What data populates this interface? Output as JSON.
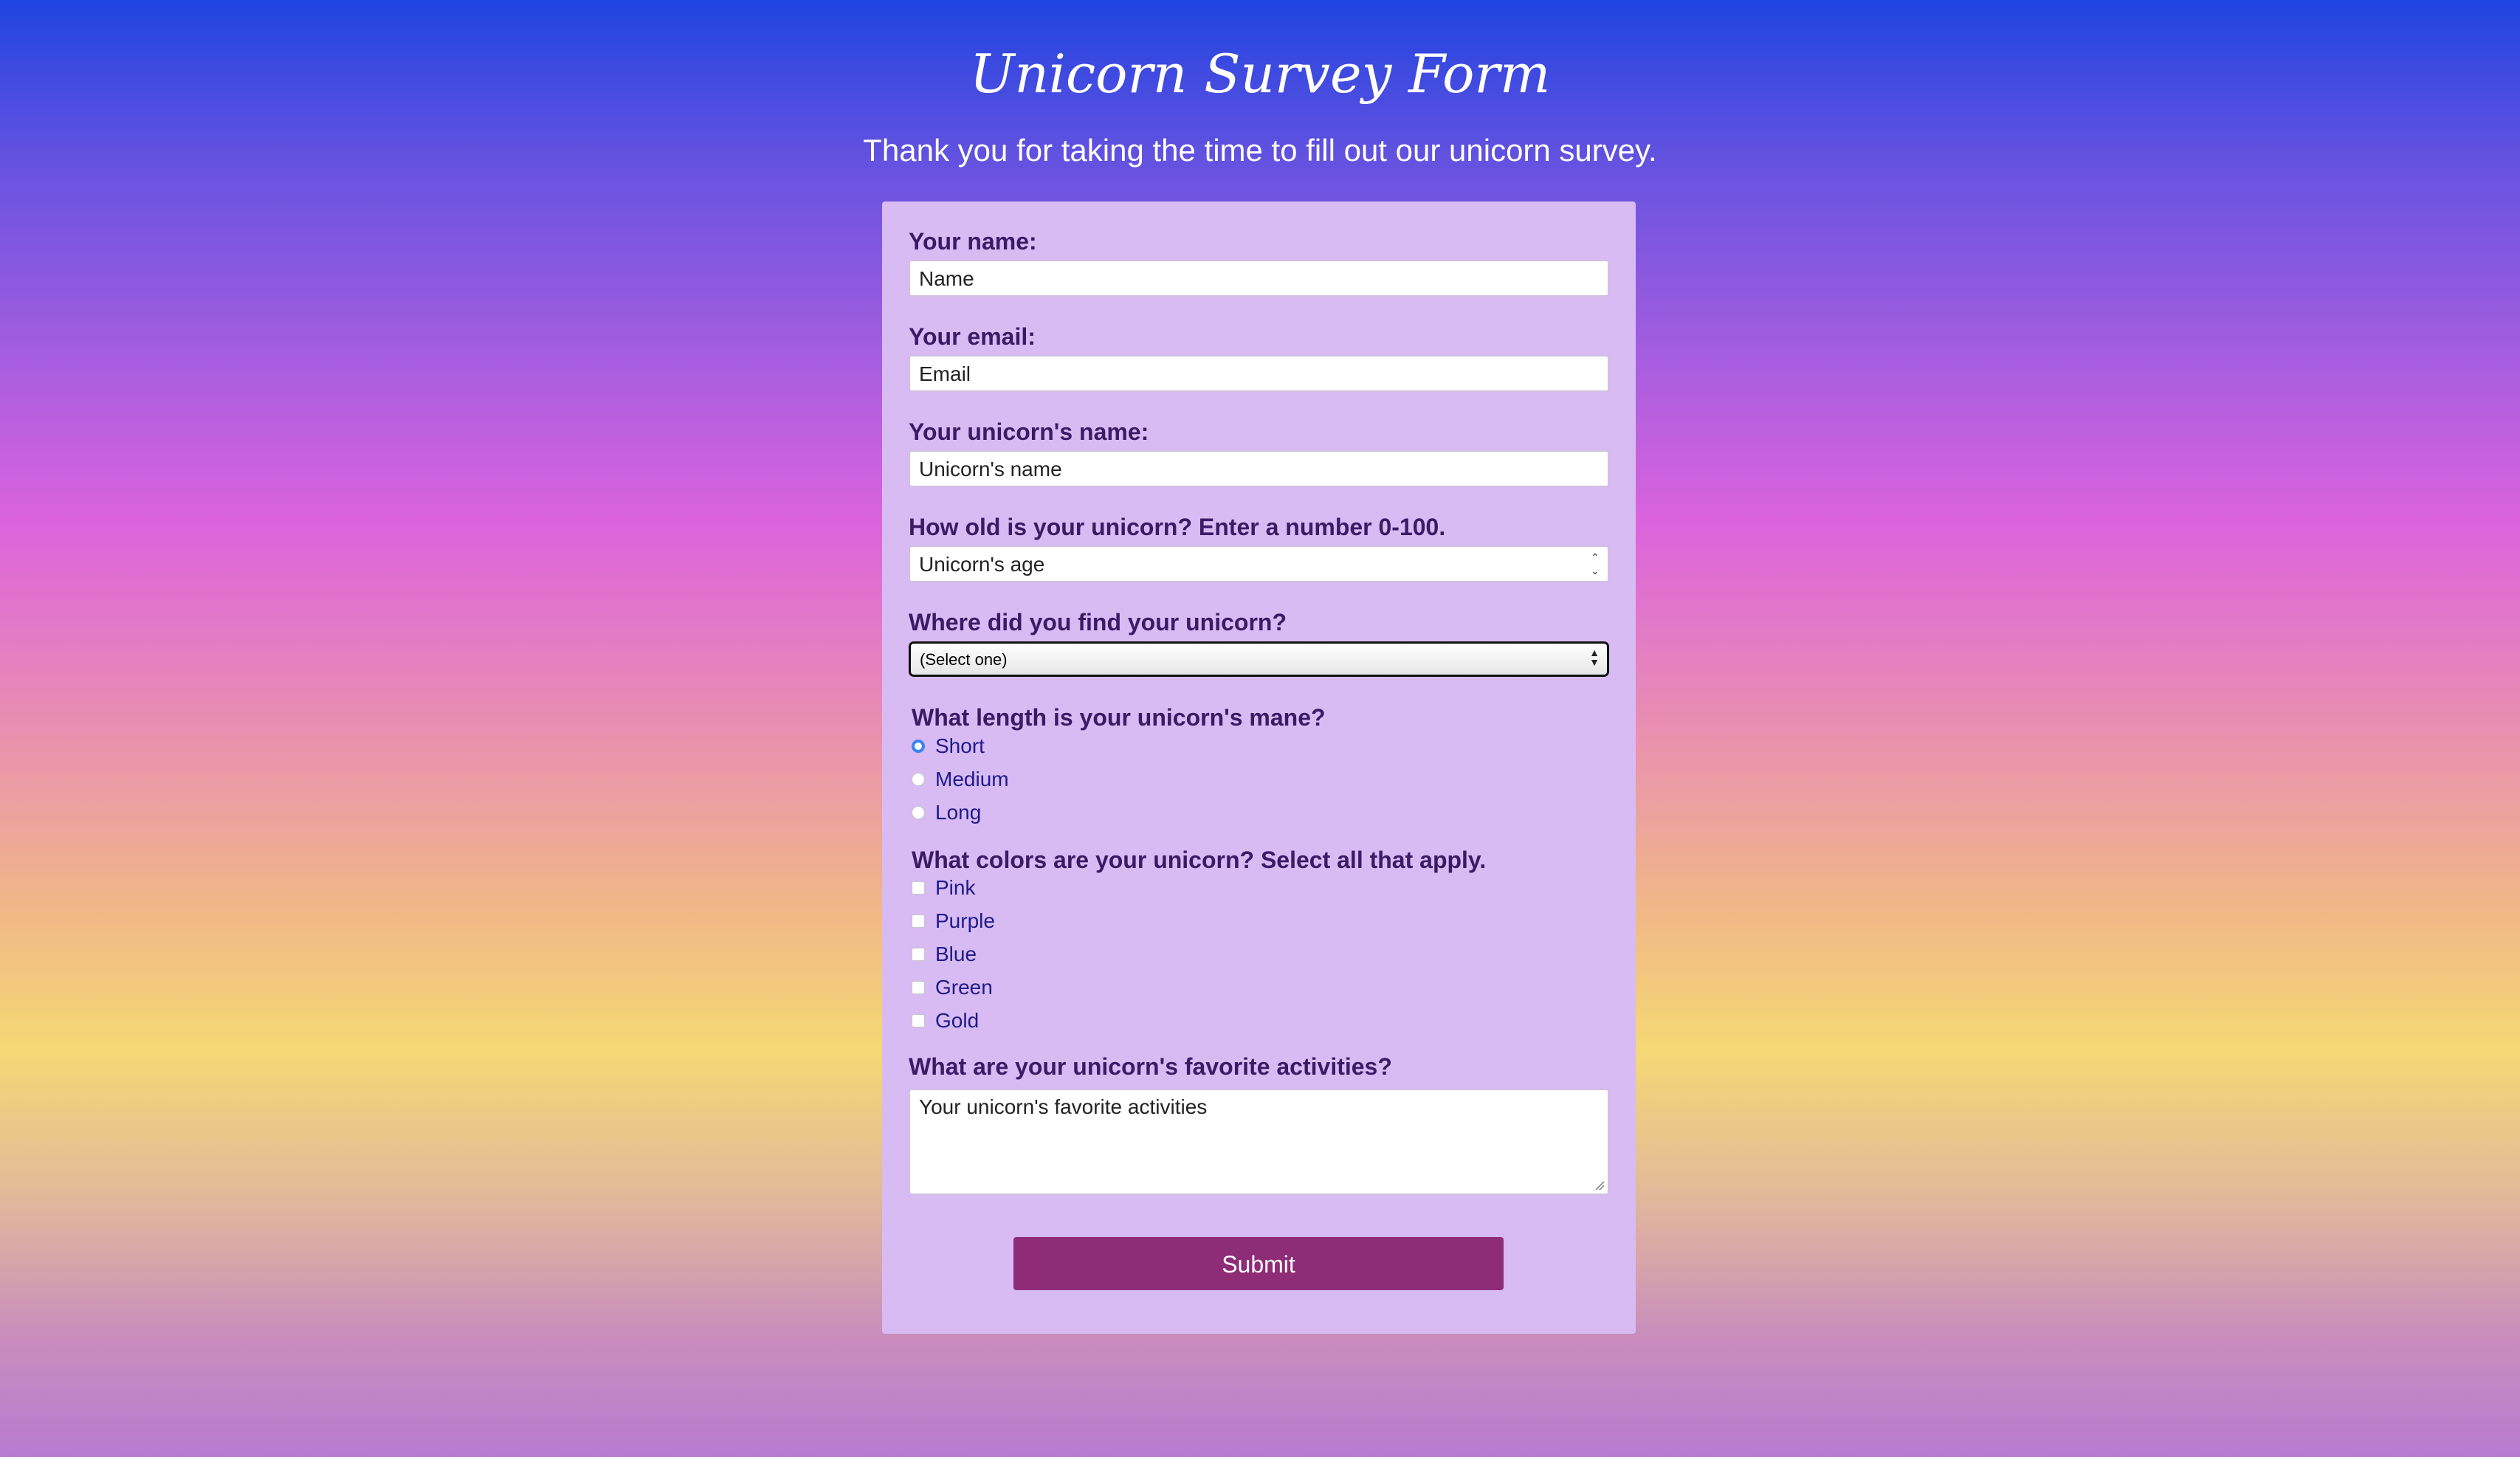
{
  "page": {
    "title": "Unicorn Survey Form",
    "subtitle": "Thank you for taking the time to fill out our unicorn survey."
  },
  "form": {
    "name": {
      "label": "Your name:",
      "placeholder": "Name"
    },
    "email": {
      "label": "Your email:",
      "placeholder": "Email"
    },
    "unicorn_name": {
      "label": "Your unicorn's name:",
      "placeholder": "Unicorn's name"
    },
    "age": {
      "label": "How old is your unicorn? Enter a number 0-100.",
      "placeholder": "Unicorn's age"
    },
    "found": {
      "label": "Where did you find your unicorn?",
      "selected": "(Select one)"
    },
    "mane": {
      "label": "What length is your unicorn's mane?",
      "options": [
        {
          "label": "Short",
          "checked": true
        },
        {
          "label": "Medium",
          "checked": false
        },
        {
          "label": "Long",
          "checked": false
        }
      ]
    },
    "colors": {
      "label": "What colors are your unicorn? Select all that apply.",
      "options": [
        {
          "label": "Pink",
          "checked": false
        },
        {
          "label": "Purple",
          "checked": false
        },
        {
          "label": "Blue",
          "checked": false
        },
        {
          "label": "Green",
          "checked": false
        },
        {
          "label": "Gold",
          "checked": false
        }
      ]
    },
    "activities": {
      "label": "What are your unicorn's favorite activities?",
      "placeholder": "Your unicorn's favorite activities"
    },
    "submit_label": "Submit"
  },
  "colors": {
    "card_background": "#d8bbf2",
    "label_text": "#3b1a66",
    "option_text": "#1f1a8a",
    "submit_background": "#8e2c78",
    "radio_checked": "#3b82f6"
  }
}
